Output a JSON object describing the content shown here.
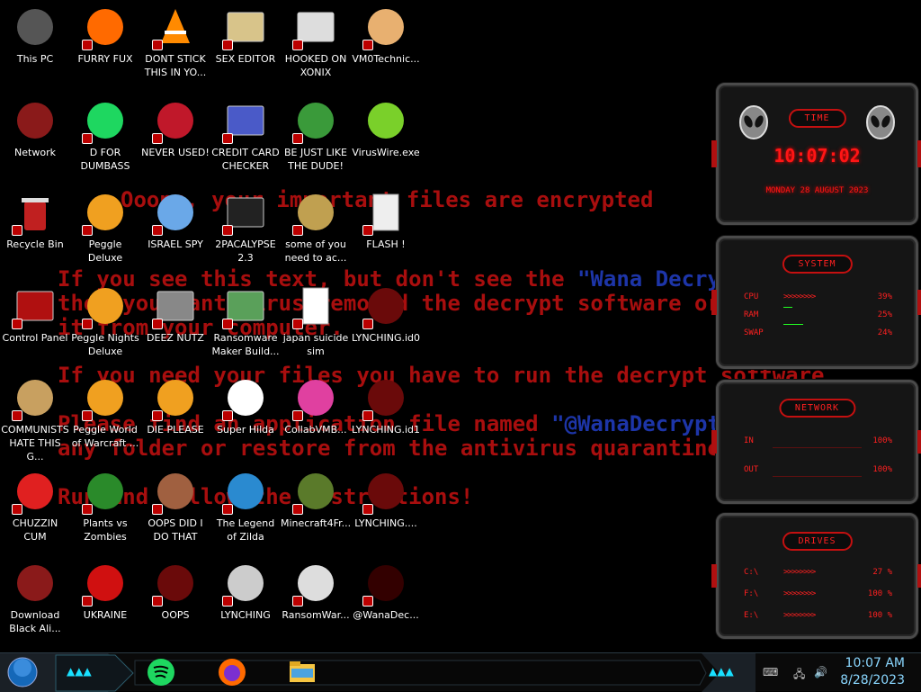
{
  "ransom_lines": {
    "l1": "Ooops, your important files are encrypted",
    "l2a": "If you see this text, but don't see the ",
    "l2b": "\"Wana Decrypt0r\"",
    "l3": "then your antivirus removed the decrypt software or",
    "l4": "it from your computer.",
    "l5": "If you need your files you have to run the decrypt software",
    "l6a": "Please find an application file named ",
    "l6b": "\"@WanaDecryptor@.exe\"",
    "l7": "any folder or restore from the antivirus quarantine.",
    "l8": "Run and follow the instructions!"
  },
  "icons": [
    {
      "label": "This PC",
      "icon": "computer-icon"
    },
    {
      "label": "FURRY FUX",
      "icon": "firefox-icon"
    },
    {
      "label": "DONT STICK THIS IN YO...",
      "icon": "vlc-cone-icon"
    },
    {
      "label": "SEX EDITOR",
      "icon": "hxd-editor-icon"
    },
    {
      "label": "HOOKED ON XONIX",
      "icon": "xonix-game-icon"
    },
    {
      "label": "VM0Technic...",
      "icon": "doctor-icon"
    },
    {
      "label": "Network",
      "icon": "alienware-orb-icon"
    },
    {
      "label": "D FOR DUMBASS",
      "icon": "spotify-icon"
    },
    {
      "label": "NEVER USED!",
      "icon": "devcpp-icon"
    },
    {
      "label": "CREDIT CARD CHECKER",
      "icon": "credit-card-icon"
    },
    {
      "label": "BE JUST LIKE THE DUDE!",
      "icon": "elf-icon"
    },
    {
      "label": "VirusWire.exe",
      "icon": "lime-icon"
    },
    {
      "label": "Recycle Bin",
      "icon": "recycle-bin-icon"
    },
    {
      "label": "Peggle Deluxe",
      "icon": "peggle-icon"
    },
    {
      "label": "ISRAEL SPY",
      "icon": "spy-network-icon"
    },
    {
      "label": "2PACALYPSE 2.3",
      "icon": "terminal-icon"
    },
    {
      "label": "some of you need to ac...",
      "icon": "dog-icon"
    },
    {
      "label": "FLASH !",
      "icon": "flash-icon"
    },
    {
      "label": "Control Panel",
      "icon": "control-panel-icon"
    },
    {
      "label": "Peggle Nights Deluxe",
      "icon": "peggle-icon"
    },
    {
      "label": "DEEZ NUTZ",
      "icon": "windows-stack-icon"
    },
    {
      "label": "Ransomware Maker Build...",
      "icon": "app-window-icon"
    },
    {
      "label": "japan suicide sim",
      "icon": "document-icon"
    },
    {
      "label": "LYNCHING.id0",
      "icon": "alienware-file-icon"
    },
    {
      "label": "COMMUNISTS HATE THIS G...",
      "icon": "money-bag-icon"
    },
    {
      "label": "Peggle World of Warcraft ...",
      "icon": "peggle-icon"
    },
    {
      "label": "DIE PLEASE",
      "icon": "de-icon"
    },
    {
      "label": "Super Hilda",
      "icon": "pixel-dog-icon"
    },
    {
      "label": "CollabVMB...",
      "icon": "collabvm-icon"
    },
    {
      "label": "LYNCHING.id1",
      "icon": "alienware-file-icon"
    },
    {
      "label": "CHUZZIN CUM",
      "icon": "chuzzle-icon"
    },
    {
      "label": "Plants vs Zombies",
      "icon": "plant-icon"
    },
    {
      "label": "OOPS DID I DO THAT",
      "icon": "portrait-icon"
    },
    {
      "label": "The Legend of Zilda",
      "icon": "pixel-hero-icon"
    },
    {
      "label": "Minecraft4Fr...",
      "icon": "minecraft-block-icon"
    },
    {
      "label": "LYNCHING....",
      "icon": "alienware-file-icon"
    },
    {
      "label": "Download Black Ali...",
      "icon": "alienware-orb-icon"
    },
    {
      "label": "UKRAINE",
      "icon": "radiation-icon"
    },
    {
      "label": "OOPS",
      "icon": "alienware-file-icon"
    },
    {
      "label": "LYNCHING",
      "icon": "network-tree-icon"
    },
    {
      "label": "RansomWar...",
      "icon": "skull-icon"
    },
    {
      "label": "@WanaDec...",
      "icon": "wanacry-icon"
    }
  ],
  "widget": {
    "time_title": "TIME",
    "time_value": "10:07:02",
    "date_value": "MONDAY 28 AUGUST 2023",
    "system_title": "SYSTEM",
    "cpu_label": "CPU",
    "cpu_value": "39%",
    "ram_label": "RAM",
    "ram_value": "25%",
    "swap_label": "SWAP",
    "swap_value": "24%",
    "network_title": "NETWORK",
    "in_label": "IN",
    "in_value": "100%",
    "out_label": "OUT",
    "out_value": "100%",
    "drives_title": "DRIVES",
    "drive_c_label": "C:\\",
    "drive_c_value": "27 %",
    "drive_f_label": "F:\\",
    "drive_f_value": "100 %",
    "drive_e_label": "E:\\",
    "drive_e_value": "100 %",
    "bar_glyphs": ">>>>>>>>",
    "accent": "#ff1a1a"
  },
  "taskbar": {
    "start": "start-orb-icon",
    "apps": [
      "spotify-icon",
      "firefox-icon",
      "file-explorer-icon"
    ],
    "clock_time": "10:07 AM",
    "clock_date": "8/28/2023",
    "tray": [
      "keyboard-icon",
      "network-icon",
      "volume-icon"
    ]
  }
}
